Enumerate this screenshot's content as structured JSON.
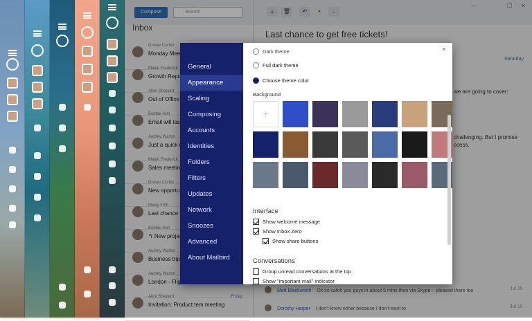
{
  "app": {
    "compose_label": "Compose",
    "search_placeholder": "Search",
    "inbox_title": "Inbox",
    "message_title": "Last chance to get free tickets!",
    "message_date": "Saturday",
    "message_snippets": [
      "we are going to cover:",
      "challenging. But I promise",
      "ccess."
    ],
    "replies": [
      {
        "from": "Matt Blacksmith",
        "text": "Ok so catch you guys in about 5 mins then via Skype – pleased there too",
        "date": "Jul 20"
      },
      {
        "from": "Dorothy Harper",
        "text": "I don't know either because I don't want to",
        "date": "Jul 19"
      }
    ]
  },
  "mails": [
    {
      "from": "Grover Cortez",
      "subject": "Monday Meeti…"
    },
    {
      "from": "Malak Frederick",
      "subject": "Growth Repo…"
    },
    {
      "from": "Alice Shepard",
      "subject": "Out of Office"
    },
    {
      "from": "Bobbie Holt",
      "subject": "Email will last"
    },
    {
      "from": "Audrey Walton",
      "subject": "Just a quick n…"
    },
    {
      "from": "Malak Frederick",
      "subject": "Sales meeting"
    },
    {
      "from": "Grover Cortez",
      "subject": "New opportun…"
    },
    {
      "from": "Maisy Firth",
      "subject": "Last chance to"
    },
    {
      "from": "Bobbie Holt",
      "subject": "↰ New project"
    },
    {
      "from": "Audrey Walton",
      "subject": "Business trip"
    },
    {
      "from": "Audrey Walton",
      "subject": "London - Flight tickets"
    },
    {
      "from": "Alice Shepard",
      "subject": "Invitation: Product tem meeting",
      "date": "Friday"
    }
  ],
  "settings": {
    "nav": [
      "General",
      "Appearance",
      "Scaling",
      "Composing",
      "Accounts",
      "Identities",
      "Folders",
      "Filters",
      "Updates",
      "Network",
      "Snoozes",
      "Advanced",
      "About Mailbird"
    ],
    "active_nav": "Appearance",
    "close_label": "×",
    "themes": {
      "dark_theme": "Dark theme",
      "full_dark_theme": "Full dark theme",
      "choose_color": "Choose theme color",
      "selected": "Choose theme color"
    },
    "background_label": "Background",
    "interface_label": "Interface",
    "interface_options": [
      {
        "label": "Show welcome message",
        "checked": true
      },
      {
        "label": "Show Inbox Zero",
        "checked": true
      },
      {
        "label": "Show share buttons",
        "checked": true
      }
    ],
    "conversations_label": "Conversations",
    "conversation_options": [
      {
        "label": "Group unread conversations at the top",
        "checked": false
      },
      {
        "label": "Show \"important mail\" indicator",
        "checked": false
      }
    ],
    "background_colors": [
      "#ffffff",
      "#2f4fc8",
      "#3a3258",
      "#9a9a9a",
      "#2a3c7a",
      "#c8a27a",
      "#7a6a5a",
      "#15216b",
      "#8a5a32",
      "#3a3a3a",
      "#5a5a5a",
      "#4a6aa8",
      "#1a1a1a",
      "#c07a7a",
      "#6a7a8a",
      "#4a5a6a",
      "#6a2a2a",
      "#8a8a9a",
      "#2a2a2a",
      "#9a5a6a",
      "#5a6a7a"
    ]
  },
  "colors": {
    "accent": "#15216b",
    "compose": "#2f6fb5",
    "date": "#2f7fc1"
  }
}
